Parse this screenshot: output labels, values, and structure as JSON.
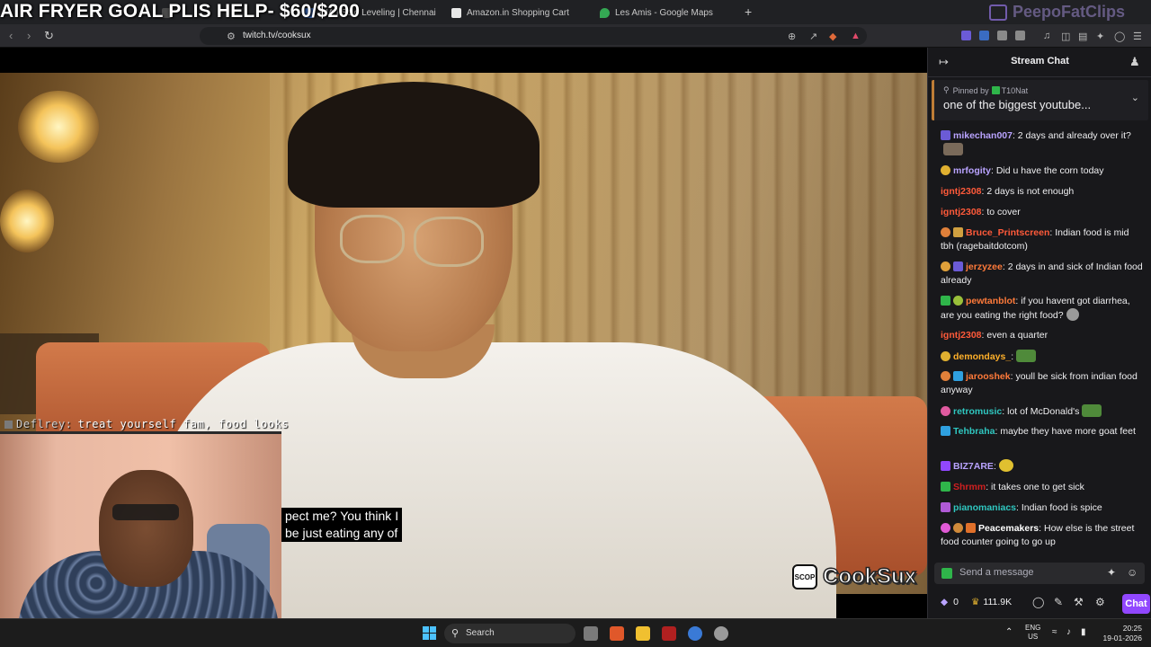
{
  "stream_overlay": {
    "goal_title": "AIR FRYER GOAL PLIS HELP- $60/$200",
    "watermark": "PeepoFatClips"
  },
  "browser": {
    "tabs": [
      {
        "label": "",
        "color": "#4a4a4a"
      },
      {
        "label": "DIA | Solo Leveling | Chennai",
        "color": "#3a6cc2"
      },
      {
        "label": "Amazon.in Shopping Cart",
        "color": "#e8e8e8"
      },
      {
        "label": "Les Amis - Google Maps",
        "color": "#34a853"
      }
    ],
    "new_tab": "+",
    "url": "twitch.tv/cooksux"
  },
  "video": {
    "overlay_chat_user": "Deflrey:",
    "overlay_chat_text": "treat yourself fam, food looks",
    "subtitle_lines": [
      "pect me? You think I",
      "be just eating any of"
    ],
    "brand_badge": "SCOP",
    "brand_name": "CookSux"
  },
  "chat": {
    "title": "Stream Chat",
    "pinned_by_label": "Pinned by",
    "pinned_by_user": "T10Nat",
    "pinned_message": "one of the biggest youtube...",
    "messages": [
      {
        "user": "mikechan007",
        "color": "#b9a3ff",
        "text": ": 2 days and already over it?",
        "badge": "#6b5bd6",
        "emote": "#7a6a5a"
      },
      {
        "user": "mrfogity",
        "color": "#b9a3ff",
        "text": ": Did u have the corn today",
        "badge": "#e0b030",
        "emote": ""
      },
      {
        "user": "igntj2308",
        "color": "#ff5a3a",
        "text": ": 2 days is not enough",
        "badge": "",
        "emote": ""
      },
      {
        "user": "igntj2308",
        "color": "#ff5a3a",
        "text": ": to cover",
        "badge": "",
        "emote": ""
      },
      {
        "user": "Bruce_Printscreen",
        "color": "#ff5a3a",
        "text": ": Indian food is mid tbh (ragebaitdotcom)",
        "badge": "#e0803a",
        "emote": ""
      },
      {
        "user": "jerzyzee",
        "color": "#ff7a3a",
        "text": ": 2 days in and sick of Indian food already",
        "badge": "#e0a03a",
        "emote": ""
      },
      {
        "user": "pewtanblot",
        "color": "#ff7a3a",
        "text": ": if you havent got diarrhea, are you eating the right food?",
        "badge": "#2fb54a",
        "emote": "#9a9a9a"
      },
      {
        "user": "igntj2308",
        "color": "#ff5a3a",
        "text": ": even a quarter",
        "badge": "",
        "emote": ""
      },
      {
        "user": "demondays_",
        "color": "#ffb02a",
        "text": ":",
        "badge": "#e0b030",
        "emote": "#4f8a3a"
      },
      {
        "user": "jarooshek",
        "color": "#ff7a3a",
        "text": ": youll be sick from indian food anyway",
        "badge": "#e0803a",
        "emote": ""
      },
      {
        "user": "retromusic",
        "color": "#2fc7c0",
        "text": ": lot of McDonald's",
        "badge": "#e05aa0",
        "emote": "#4f8a3a"
      },
      {
        "user": "Tehbraha",
        "color": "#2fc7c0",
        "text": ": maybe they have more goat feet",
        "badge": "#2fa0e0",
        "emote": ""
      },
      {
        "user": "BIZ7ARE",
        "color": "#b9a3ff",
        "text": ":",
        "badge": "#9147ff",
        "emote": "#e0c030"
      },
      {
        "user": "Shrmm",
        "color": "#d02020",
        "text": ": it takes one to get sick",
        "badge": "#2fb54a",
        "emote": ""
      },
      {
        "user": "pianomaniacs",
        "color": "#2fc7c0",
        "text": ": Indian food is spice",
        "badge": "#b05ad6",
        "emote": ""
      },
      {
        "user": "Peacemakers",
        "color": "#ffffff",
        "text": ": How else is the street food counter going to go up",
        "badge": "#e05ad6",
        "emote": ""
      }
    ],
    "compose_placeholder": "Send a message",
    "points": "0",
    "viewers": "111.9K",
    "chat_button": "Chat"
  },
  "taskbar": {
    "search": "Search",
    "lang_top": "ENG",
    "lang_bottom": "US",
    "time": "20:25",
    "date": "19-01-2026"
  }
}
